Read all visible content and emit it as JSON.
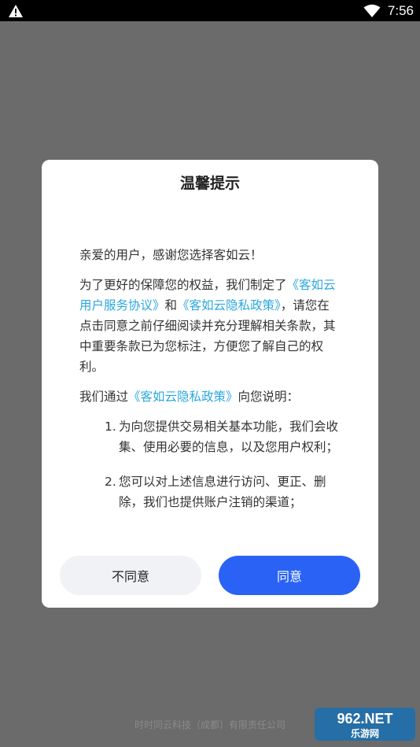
{
  "status_bar": {
    "time": "7:56"
  },
  "dialog": {
    "title": "温馨提示",
    "greeting": "亲爱的用户，感谢您选择客如云！",
    "intro_prefix": "为了更好的保障您的权益，我们制定了",
    "link_service": "《客如云用户服务协议》",
    "intro_and": "和",
    "link_privacy": "《客如云隐私政策》",
    "intro_suffix": "，请您在点击同意之前仔细阅读并充分理解相关条款，其中重要条款已为您标注，方便您了解自己的权利。",
    "explain_prefix": "我们通过",
    "explain_link": "《客如云隐私政策》",
    "explain_suffix": "向您说明：",
    "items": [
      {
        "num": "1.",
        "text": "为向您提供交易相关基本功能，我们会收集、使用必要的信息，以及您用户权利；"
      },
      {
        "num": "2.",
        "text": "您可以对上述信息进行访问、更正、删除，我们也提供账户注销的渠道；"
      }
    ],
    "disagree_label": "不同意",
    "agree_label": "同意"
  },
  "footer": {
    "company": "时时同云科技（成都）有限责任公司"
  },
  "watermark": {
    "text_top": "962.NET",
    "text_bottom": "乐游网"
  },
  "colors": {
    "link": "#2aa7de",
    "agree_button": "#2962f5",
    "disagree_button": "#f1f2f6",
    "overlay": "#6b6b6b"
  }
}
